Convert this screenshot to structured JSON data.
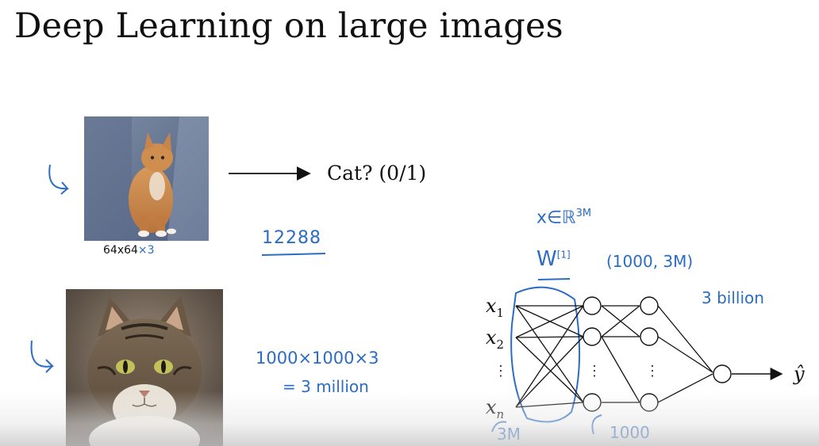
{
  "slide": {
    "title": "Deep Learning on large images",
    "small_image": {
      "caption_main": "64x64",
      "caption_ink": "×3"
    },
    "arrow_label": "Cat? (0/1)",
    "annotations": {
      "features_small": "12288",
      "features_large_line1": "1000×1000×3",
      "features_large_line2": "= 3 million",
      "x_in": "x∈ℝ",
      "x_in_sup": "3M",
      "weight": "W",
      "weight_sup": "[1]",
      "weight_shape": "(1000, 3M)",
      "billion": "3 billion",
      "input_count": "3M",
      "hidden_count": "1000"
    },
    "network": {
      "inputs": [
        "x",
        "x",
        "x"
      ],
      "input_subs": [
        "1",
        "2",
        "n"
      ],
      "ellipsis": "⋮",
      "output": "ŷ"
    },
    "colors": {
      "ink": "#2b6cc4",
      "text": "#111111"
    }
  }
}
